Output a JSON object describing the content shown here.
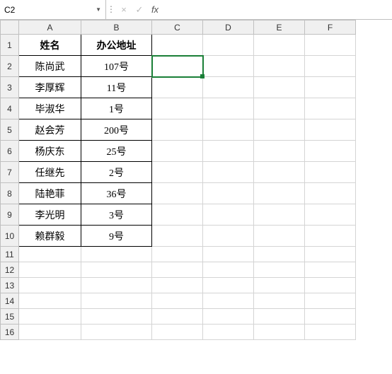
{
  "formula_bar": {
    "name_box": "C2",
    "cancel": "×",
    "enter": "✓",
    "fx": "fx",
    "formula": ""
  },
  "columns": [
    "A",
    "B",
    "C",
    "D",
    "E",
    "F"
  ],
  "rows": [
    "1",
    "2",
    "3",
    "4",
    "5",
    "6",
    "7",
    "8",
    "9",
    "10",
    "11",
    "12",
    "13",
    "14",
    "15",
    "16"
  ],
  "headers": {
    "name": "姓名",
    "office": "办公地址"
  },
  "records": [
    {
      "name": "陈尚武",
      "office": "107号"
    },
    {
      "name": "李厚辉",
      "office": "11号"
    },
    {
      "name": "毕淑华",
      "office": "1号"
    },
    {
      "name": "赵会芳",
      "office": "200号"
    },
    {
      "name": "杨庆东",
      "office": "25号"
    },
    {
      "name": "任继先",
      "office": "2号"
    },
    {
      "name": "陆艳菲",
      "office": "36号"
    },
    {
      "name": "李光明",
      "office": "3号"
    },
    {
      "name": "赖群毅",
      "office": "9号"
    }
  ],
  "active_cell": "C2"
}
